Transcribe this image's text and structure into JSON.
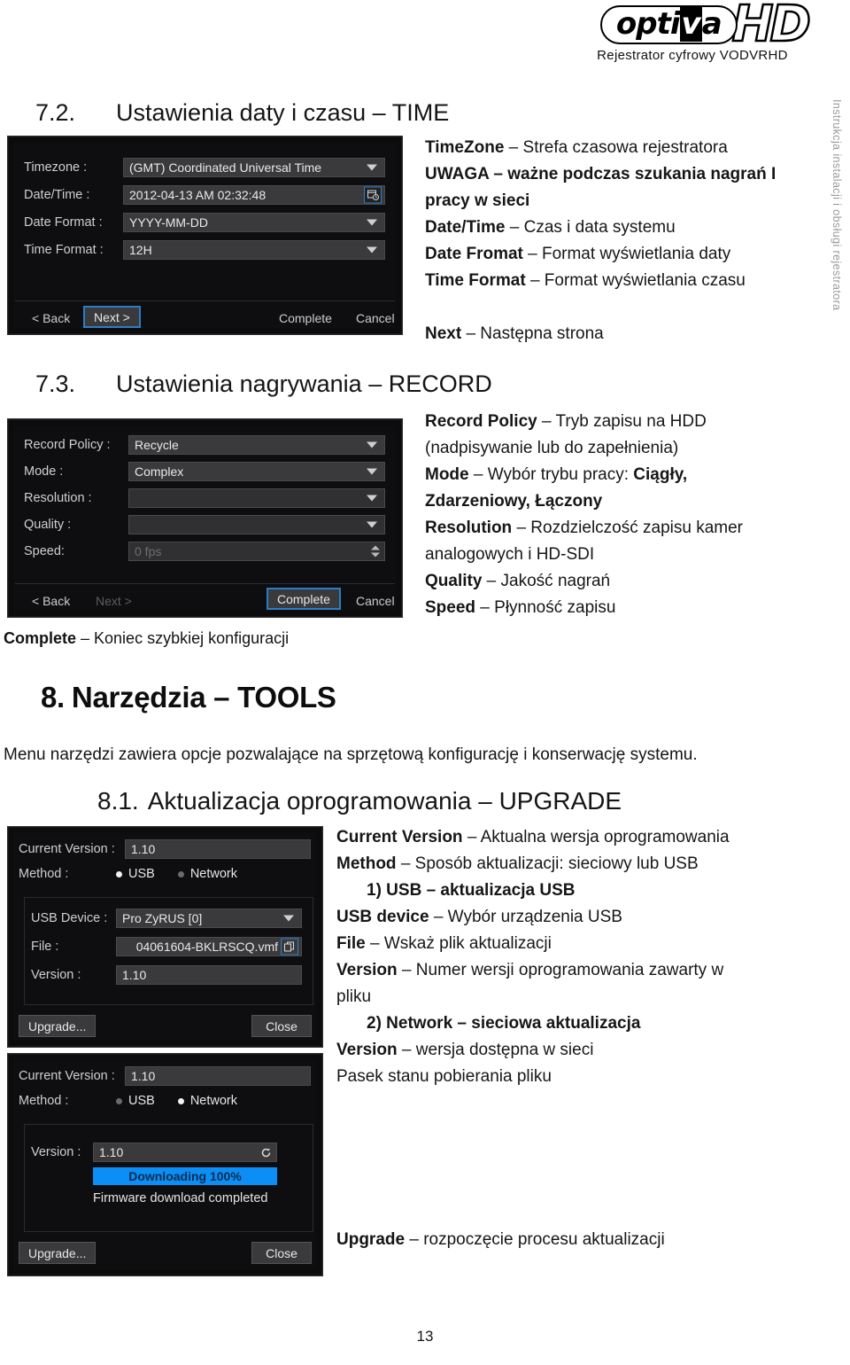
{
  "brand": {
    "logo_main": "opti",
    "logo_v": "v",
    "logo_a": "a",
    "logo_hd": "HD",
    "tagline": "Rejestrator  cyfrowy  VODVRHD"
  },
  "side_tab": {
    "label": "Instrukcja instalacji i obsługi rejestratora"
  },
  "page": {
    "number": "13"
  },
  "sections": {
    "s72": {
      "number": "7.2.",
      "title": "Ustawienia daty i czasu – TIME"
    },
    "s73": {
      "number": "7.3.",
      "title": "Ustawienia nagrywania – RECORD"
    },
    "s8": {
      "number": "8.",
      "title": "Narzędzia – TOOLS"
    },
    "s81": {
      "number": "8.1.",
      "title": "Aktualizacja oprogramowania – UPGRADE"
    }
  },
  "time_panel": {
    "fields": [
      {
        "label": "Timezone :",
        "value": "(GMT) Coordinated Universal Time",
        "control": "dropdown"
      },
      {
        "label": "Date/Time :",
        "value": "2012-04-13 AM 02:32:48",
        "control": "calendar"
      },
      {
        "label": "Date Format :",
        "value": "YYYY-MM-DD",
        "control": "dropdown"
      },
      {
        "label": "Time Format :",
        "value": "12H",
        "control": "dropdown"
      }
    ],
    "buttons": {
      "back": "< Back",
      "next": "Next >",
      "complete": "Complete",
      "cancel": "Cancel"
    }
  },
  "record_panel": {
    "fields": [
      {
        "label": "Record Policy :",
        "value": "Recycle",
        "control": "dropdown"
      },
      {
        "label": "Mode :",
        "value": "Complex",
        "control": "dropdown"
      },
      {
        "label": "Resolution :",
        "value": "",
        "control": "dropdown"
      },
      {
        "label": "Quality :",
        "value": "",
        "control": "dropdown"
      },
      {
        "label": "Speed:",
        "value": "0 fps",
        "control": "spinner"
      }
    ],
    "buttons": {
      "back": "< Back",
      "next": "Next >",
      "complete": "Complete",
      "cancel": "Cancel"
    }
  },
  "upgrade_usb_panel": {
    "current_version_label": "Current Version :",
    "current_version_value": "1.10",
    "method_label": "Method :",
    "method_usb": "USB",
    "method_network": "Network",
    "method_selected": "USB",
    "usb_device_label": "USB Device :",
    "usb_device_value": "Pro ZyRUS [0]",
    "file_label": "File :",
    "file_value": "04061604-BKLRSCQ.vmf",
    "version_label": "Version :",
    "version_value": "1.10",
    "upgrade_button": "Upgrade...",
    "close_button": "Close"
  },
  "upgrade_net_panel": {
    "current_version_label": "Current Version :",
    "current_version_value": "1.10",
    "method_label": "Method :",
    "method_usb": "USB",
    "method_network": "Network",
    "method_selected": "Network",
    "version_label": "Version :",
    "version_value": "1.10",
    "progress_text": "Downloading 100%",
    "progress_percent": 100,
    "status_text": "Firmware download completed",
    "upgrade_button": "Upgrade...",
    "close_button": "Close"
  },
  "time_text": {
    "l1_b": "TimeZone",
    "l1_r": " – Strefa czasowa rejestratora",
    "l2": "UWAGA – ważne podczas szukania nagrań I",
    "l3": "pracy w sieci",
    "l4_b": "Date/Time",
    "l4_r": " – Czas i data systemu",
    "l5_b": "Date Fromat",
    "l5_r": " – Format wyświetlania daty",
    "l6_b": "Time Format",
    "l6_r": " – Format wyświetlania czasu",
    "l7_b": "Next",
    "l7_r": " – Następna strona"
  },
  "record_text": {
    "l1_b": "Record Policy",
    "l1_r": " – Tryb zapisu na HDD",
    "l2": "(nadpisywanie lub do zapełnienia)",
    "l3_b": "Mode",
    "l3_r": " – Wybór trybu pracy: ",
    "l3_b2": "Ciągły,",
    "l4": "Zdarzeniowy, Łączony",
    "l5_b": "Resolution",
    "l5_r": " – Rozdzielczość zapisu kamer",
    "l6": "analogowych i HD-SDI",
    "l7_b": "Quality",
    "l7_r": " – Jakość nagrań",
    "l8_b": "Speed",
    "l8_r": " – Płynność zapisu"
  },
  "complete_note": {
    "bold": "Complete",
    "rest": " – Koniec szybkiej konfiguracji"
  },
  "tools_intro": "Menu narzędzi zawiera opcje pozwalające na sprzętową konfigurację i konserwację systemu.",
  "upgrade_text": {
    "l1_b": "Current Version",
    "l1_r": " – Aktualna wersja oprogramowania",
    "l2_b": "Method",
    "l2_r": " – Sposób aktualizacji: sieciowy lub USB",
    "l3_b": "1)   USB – aktualizacja USB",
    "l4_b": "USB device",
    "l4_r": " – Wybór urządzenia USB",
    "l5_b": "File",
    "l5_r": " – Wskaż plik aktualizacji",
    "l6_b": "Version",
    "l6_r": " – Numer wersji oprogramowania zawarty w",
    "l7": "pliku",
    "l8_b": "2)   Network – sieciowa aktualizacja",
    "l9_b": "Version",
    "l9_r": " – wersja dostępna w sieci",
    "l10": "Pasek stanu pobierania pliku"
  },
  "upgrade_note": {
    "bold": "Upgrade",
    "rest": " – rozpoczęcie procesu aktualizacji"
  },
  "colors": {
    "panel_bg": "#0c0c0d",
    "field_bg": "#3a3a3c",
    "accent_focus": "#2a7ec9",
    "progress": "#0b8ef5",
    "sidetab_text": "#9a9a9a"
  },
  "icons": {
    "dropdown": "chevron-down-icon",
    "calendar": "calendar-clock-icon",
    "spinner": "spinner-updown-icon",
    "browse": "folder-browse-icon",
    "refresh": "refresh-icon"
  }
}
